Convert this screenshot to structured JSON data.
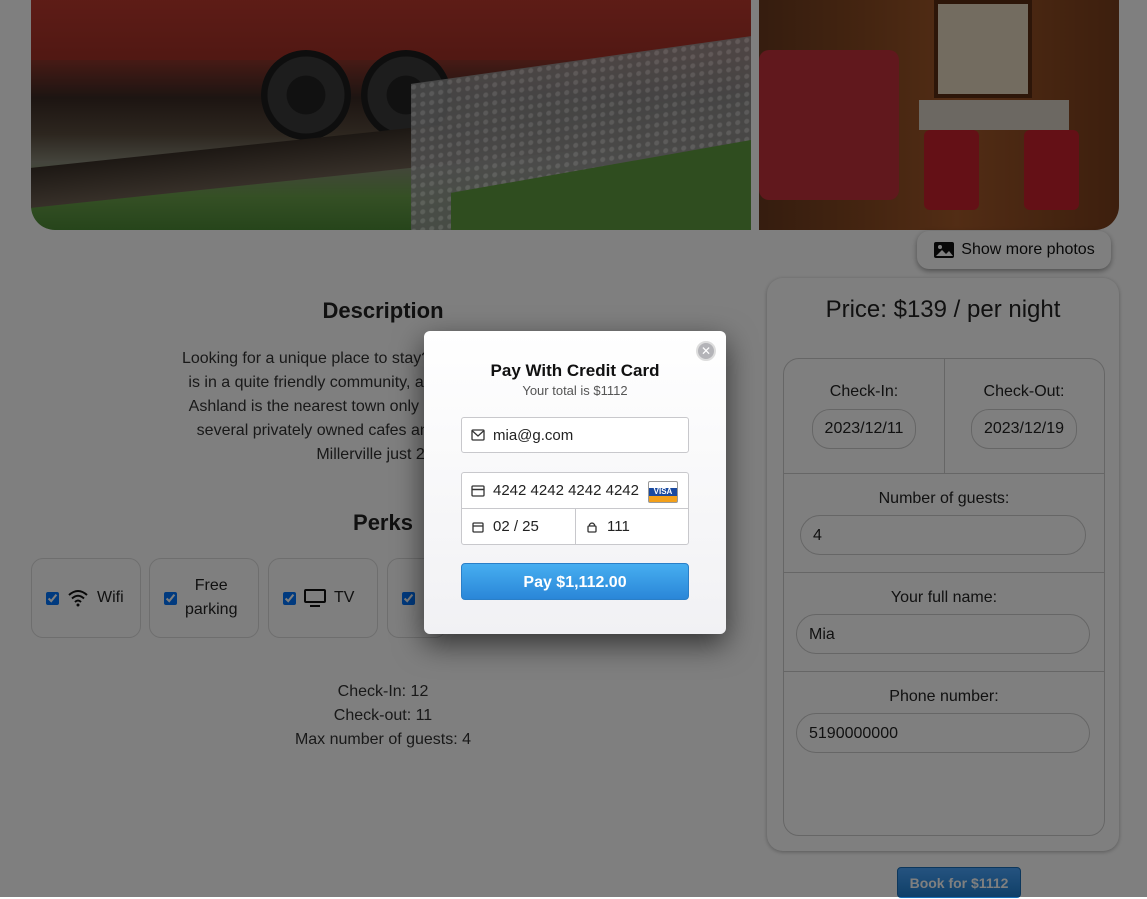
{
  "gallery": {
    "show_more_label": "Show more photos",
    "show_more_icon": "image-icon"
  },
  "description": {
    "title": "Description",
    "lines": [
      "Looking for a unique place to stay? We have it. Cap's Ca",
      "is in a quite friendly community, and is within a 30 minu",
      "Ashland is the nearest town only 6 miles away and has",
      "several privately owned cafes and a Piggly Wiggly fo",
      "Millerville just 2 mil"
    ],
    "trail_right": [
      "t",
      "."
    ]
  },
  "perks": {
    "title": "Perks",
    "items": [
      {
        "label": "Wifi",
        "icon": "wifi-icon",
        "checked": true
      },
      {
        "label_line1": "Free",
        "label_line2": "parking",
        "checked": true
      },
      {
        "label": "TV",
        "icon": "tv-icon",
        "checked": true
      },
      {
        "label": "",
        "checked": true
      }
    ]
  },
  "info": {
    "check_in": "Check-In: 12",
    "check_out": "Check-out: 11",
    "max_guests": "Max number of guests: 4"
  },
  "booking": {
    "price": "Price: $139 / per night",
    "check_in_label": "Check-In:",
    "check_in_value": "2023/12/11",
    "check_out_label": "Check-Out:",
    "check_out_value": "2023/12/19",
    "guests_label": "Number of guests:",
    "guests_value": "4",
    "name_label": "Your full name:",
    "name_value": "Mia",
    "phone_label": "Phone number:",
    "phone_value": "5190000000",
    "book_button": "Book for $1112"
  },
  "payment_modal": {
    "title": "Pay With Credit Card",
    "subtitle": "Your total is $1112",
    "email": "mia@g.com",
    "card_number": "4242 4242 4242 4242",
    "card_brand": "VISA",
    "expiry": "02 / 25",
    "cvc": "111",
    "pay_button": "Pay $1,112.00"
  }
}
